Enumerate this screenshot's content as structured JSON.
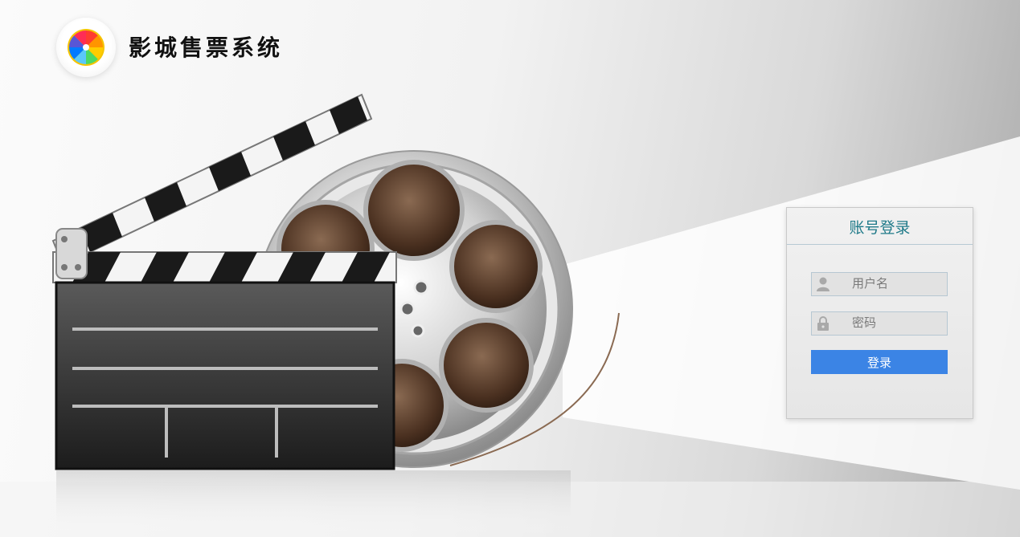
{
  "app": {
    "title": "影城售票系统"
  },
  "login": {
    "header": "账号登录",
    "username_placeholder": "用户名",
    "password_placeholder": "密码",
    "submit_label": "登录"
  },
  "colors": {
    "header_text": "#1f7a89",
    "button_bg": "#3b84e5",
    "button_text": "#ffffff"
  },
  "icons": {
    "logo": "color-wheel-logo-icon",
    "username": "user-icon",
    "password": "lock-icon"
  }
}
